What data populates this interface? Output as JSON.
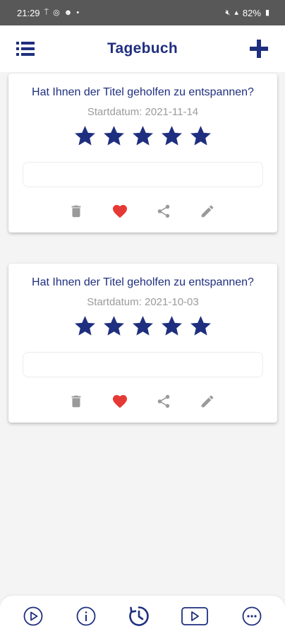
{
  "status_bar": {
    "time": "21:29",
    "battery": "82%"
  },
  "header": {
    "title": "Tagebuch",
    "menu_icon": "list-icon",
    "add_icon": "plus-icon"
  },
  "entries": [
    {
      "question": "Hat Ihnen der Titel geholfen zu entspannen?",
      "date": "Startdatum: 2021-11-14",
      "rating": 5,
      "max_rating": 5,
      "note": "",
      "liked": true
    },
    {
      "question": "Hat Ihnen der Titel geholfen zu entspannen?",
      "date": "Startdatum: 2021-10-03",
      "rating": 5,
      "max_rating": 5,
      "note": "",
      "liked": true
    }
  ],
  "bottom_nav": {
    "items": [
      "play-circle-icon",
      "info-icon",
      "history-icon",
      "video-icon",
      "more-icon"
    ],
    "active": "history-icon"
  },
  "colors": {
    "accent": "#1f2f7f",
    "star": "#1f2f7f",
    "heart": "#e53935",
    "icon_gray": "#9a9a9a",
    "status_bar": "#585858",
    "background": "#f4f4f5"
  }
}
